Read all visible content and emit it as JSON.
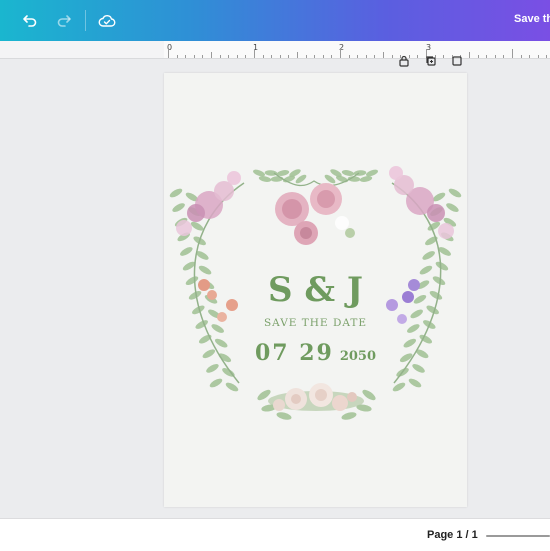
{
  "toolbar": {
    "undo_icon": "undo-icon",
    "redo_icon": "redo-icon",
    "cloud_icon": "cloud-check-icon",
    "save_label": "Save th"
  },
  "ruler": {
    "labels": [
      "0",
      "1",
      "2",
      "3"
    ]
  },
  "page_tools": [
    "lock-icon",
    "duplicate-page-icon",
    "add-page-icon"
  ],
  "card": {
    "initials": "S & J",
    "subtitle": "SAVE THE DATE",
    "date": "07 29",
    "year": "2050"
  },
  "footer": {
    "page_indicator": "Page 1 / 1"
  },
  "colors": {
    "accent_green": "#6f9b5f",
    "toolbar_start": "#1ab6cf",
    "toolbar_end": "#7a4fe4"
  }
}
